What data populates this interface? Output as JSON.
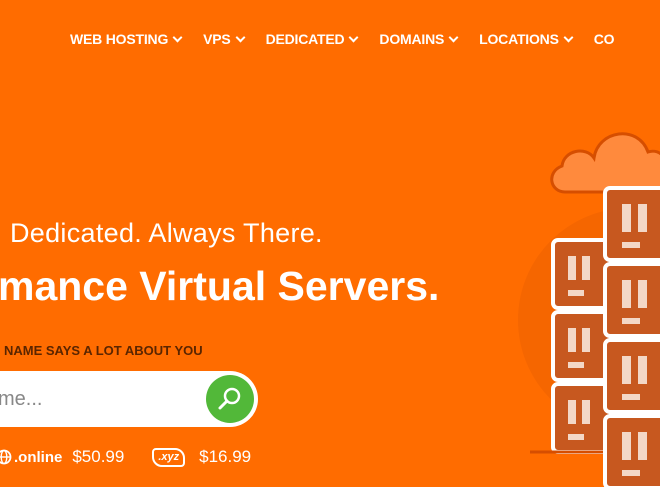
{
  "nav": {
    "items": [
      {
        "label": "WEB HOSTING"
      },
      {
        "label": "VPS"
      },
      {
        "label": "DEDICATED"
      },
      {
        "label": "DOMAINS"
      },
      {
        "label": "LOCATIONS"
      },
      {
        "label": "CO"
      }
    ]
  },
  "hero": {
    "tagline": "Dedicated. Always There.",
    "headline": "mance Virtual Servers.",
    "subtag": "NAME SAYS A LOT ABOUT YOU"
  },
  "search": {
    "placeholder": "me..."
  },
  "tlds": [
    {
      "name": ".online",
      "price": "$50.99",
      "icon": "globe-icon"
    },
    {
      "name": ".xyz",
      "price": "$16.99",
      "icon": "xyz-badge"
    }
  ],
  "colors": {
    "background": "#ff6c00",
    "search_button": "#52b839",
    "server_body": "#c7581f",
    "subtag_text": "#5a2500"
  }
}
